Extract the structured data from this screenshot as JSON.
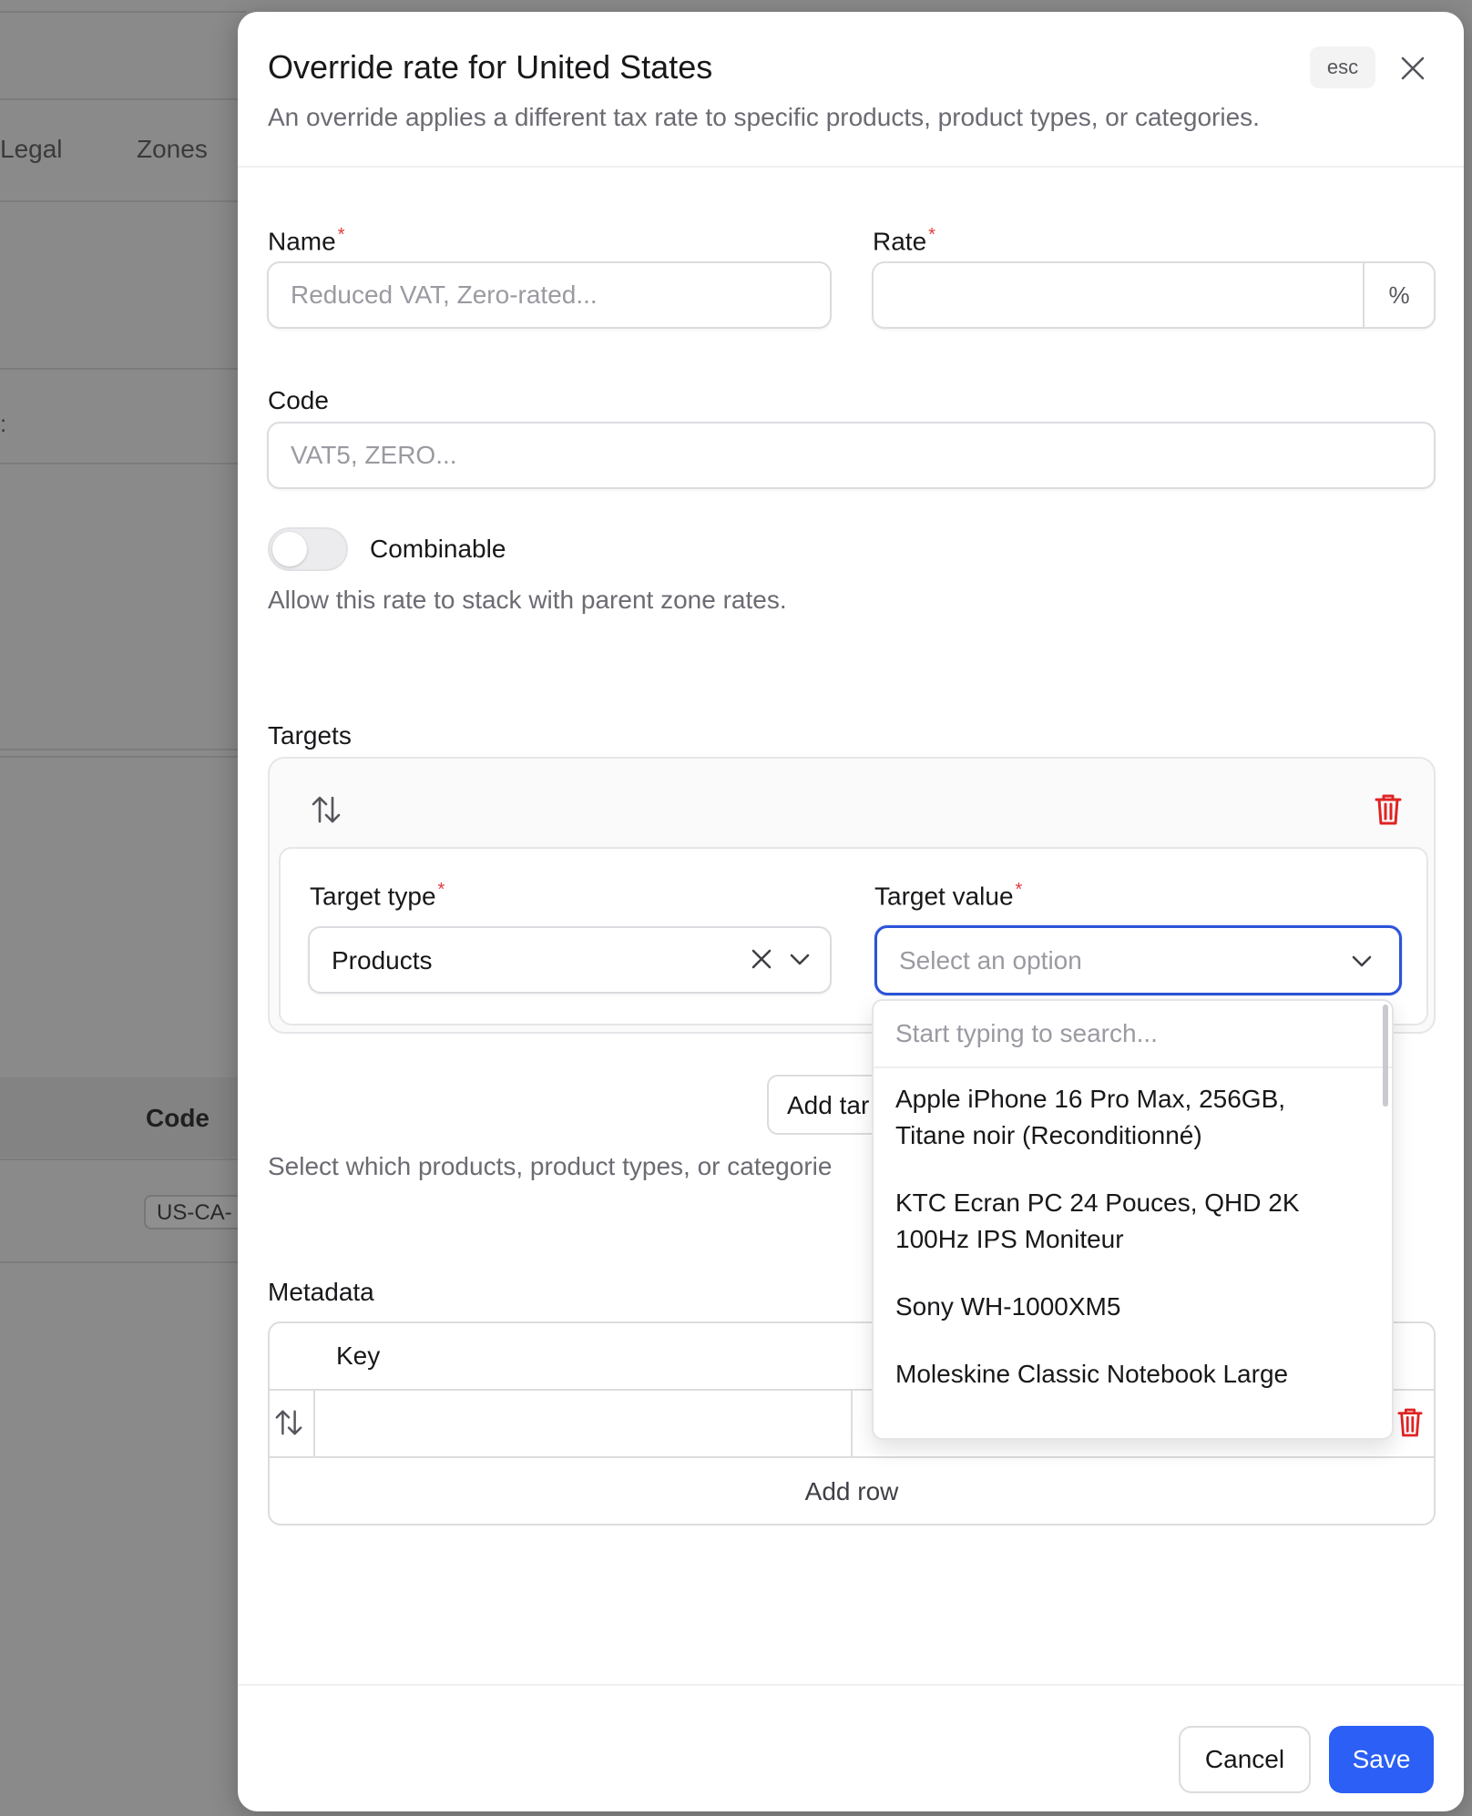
{
  "background": {
    "tabs": [
      "Legal",
      "Zones"
    ],
    "column_header": "Code",
    "chip": "US-CA-",
    "stray_mark": ":"
  },
  "modal": {
    "title": "Override rate for United States",
    "description": "An override applies a different tax rate to specific products, product types, or categories.",
    "esc_label": "esc",
    "name": {
      "label": "Name",
      "required": "*",
      "placeholder": "Reduced VAT, Zero-rated...",
      "value": ""
    },
    "rate": {
      "label": "Rate",
      "required": "*",
      "suffix": "%",
      "value": ""
    },
    "code": {
      "label": "Code",
      "placeholder": "VAT5, ZERO...",
      "value": ""
    },
    "combinable": {
      "label": "Combinable",
      "help": "Allow this rate to stack with parent zone rates.",
      "checked": false
    },
    "targets": {
      "label": "Targets",
      "target_type": {
        "label": "Target type",
        "required": "*",
        "value": "Products"
      },
      "target_value": {
        "label": "Target value",
        "required": "*",
        "placeholder": "Select an option"
      },
      "add_button": "Add tar",
      "help": "Select which products, product types, or categorie"
    },
    "metadata": {
      "label": "Metadata",
      "key_header": "Key",
      "add_row": "Add row"
    },
    "footer": {
      "cancel": "Cancel",
      "save": "Save"
    }
  },
  "dropdown": {
    "search_placeholder": "Start typing to search...",
    "options": [
      "Apple iPhone 16 Pro Max, 256GB, Titane noir (Reconditionné)",
      "KTC Ecran PC 24 Pouces, QHD 2K 100Hz IPS Moniteur",
      "Sony WH-1000XM5",
      "Moleskine Classic Notebook Large"
    ]
  },
  "colors": {
    "accent": "#2b5ff5",
    "danger": "#e02424",
    "focus": "#2c54d8"
  }
}
